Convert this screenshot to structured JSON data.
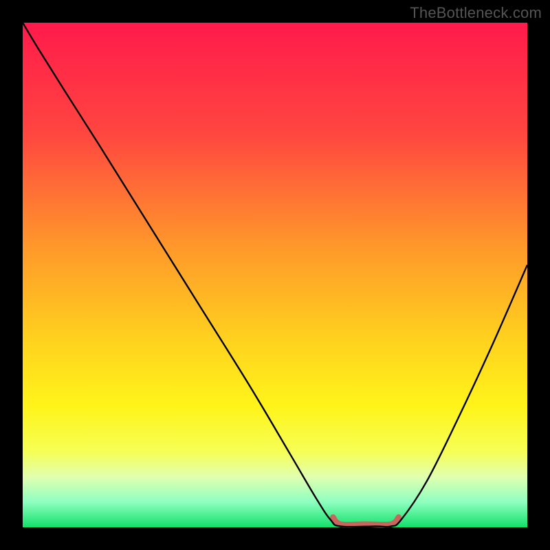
{
  "watermark": "TheBottleneck.com",
  "chart_data": {
    "type": "line",
    "title": "",
    "xlabel": "",
    "ylabel": "",
    "xlim": [
      0,
      100
    ],
    "ylim": [
      0,
      100
    ],
    "gradient_stops": [
      {
        "pct": 0,
        "color": "#ff1a4b"
      },
      {
        "pct": 22,
        "color": "#ff4640"
      },
      {
        "pct": 45,
        "color": "#ff9a2a"
      },
      {
        "pct": 63,
        "color": "#ffd21e"
      },
      {
        "pct": 76,
        "color": "#fff41a"
      },
      {
        "pct": 85,
        "color": "#f6ff55"
      },
      {
        "pct": 90,
        "color": "#e1ffb0"
      },
      {
        "pct": 95,
        "color": "#8dffc0"
      },
      {
        "pct": 100,
        "color": "#12e06a"
      }
    ],
    "series": [
      {
        "name": "bottleneck-curve",
        "color": "#000000",
        "width": 2.4,
        "points": [
          {
            "x": 0.0,
            "y": 100.0
          },
          {
            "x": 3.0,
            "y": 95.0
          },
          {
            "x": 8.0,
            "y": 87.0
          },
          {
            "x": 15.0,
            "y": 76.0
          },
          {
            "x": 25.0,
            "y": 60.0
          },
          {
            "x": 35.0,
            "y": 44.0
          },
          {
            "x": 45.0,
            "y": 28.0
          },
          {
            "x": 53.0,
            "y": 14.5
          },
          {
            "x": 58.0,
            "y": 6.0
          },
          {
            "x": 61.0,
            "y": 1.5
          },
          {
            "x": 63.0,
            "y": 0.2
          },
          {
            "x": 70.0,
            "y": 0.2
          },
          {
            "x": 73.0,
            "y": 0.2
          },
          {
            "x": 75.0,
            "y": 1.5
          },
          {
            "x": 80.0,
            "y": 9.0
          },
          {
            "x": 86.0,
            "y": 21.0
          },
          {
            "x": 93.0,
            "y": 36.0
          },
          {
            "x": 100.0,
            "y": 52.0
          }
        ]
      },
      {
        "name": "optimal-zone",
        "color": "#c9655d",
        "width": 8.5,
        "linecap": "round",
        "points": [
          {
            "x": 61.5,
            "y": 2.0
          },
          {
            "x": 63.0,
            "y": 0.6
          },
          {
            "x": 68.0,
            "y": 0.6
          },
          {
            "x": 73.0,
            "y": 0.6
          },
          {
            "x": 74.5,
            "y": 2.0
          }
        ]
      }
    ]
  }
}
